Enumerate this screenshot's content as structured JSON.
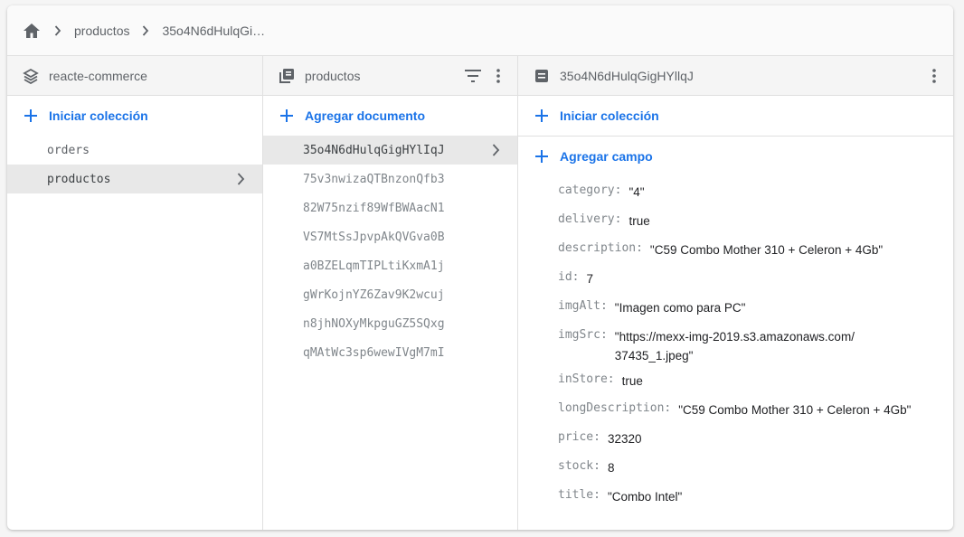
{
  "breadcrumb": {
    "items": [
      "productos",
      "35o4N6dHulqGi…"
    ]
  },
  "col1": {
    "title": "reacte-commerce",
    "action": "Iniciar colección",
    "items": [
      {
        "label": "orders",
        "selected": false
      },
      {
        "label": "productos",
        "selected": true
      }
    ]
  },
  "col2": {
    "title": "productos",
    "action": "Agregar documento",
    "items": [
      "35o4N6dHulqGigHYlIqJ",
      "75v3nwizaQTBnzonQfb3",
      "82W75nzif89WfBWAacN1",
      "VS7MtSsJpvpAkQVGva0B",
      "a0BZELqmTIPLtiKxmA1j",
      "gWrKojnYZ6Zav9K2wcuj",
      "n8jhNOXyMkpguGZ5SQxg",
      "qMAtWc3sp6wewIVgM7mI"
    ]
  },
  "col3": {
    "title": "35o4N6dHulqGigHYllqJ",
    "action_collection": "Iniciar colección",
    "action_field": "Agregar campo",
    "fields": [
      {
        "key": "category:",
        "value": "\"4\""
      },
      {
        "key": "delivery:",
        "value": "true"
      },
      {
        "key": "description:",
        "value": "\"C59 Combo Mother 310 + Celeron + 4Gb\""
      },
      {
        "key": "id:",
        "value": "7"
      },
      {
        "key": "imgAlt:",
        "value": "\"Imagen como para PC\""
      },
      {
        "key": "imgSrc:",
        "value": "\"https://mexx-img-2019.s3.amazonaws.com/37435_1.jpeg\""
      },
      {
        "key": "inStore:",
        "value": "true"
      },
      {
        "key": "longDescription:",
        "value": "\"C59 Combo Mother 310 + Celeron + 4Gb\""
      },
      {
        "key": "price:",
        "value": "32320"
      },
      {
        "key": "stock:",
        "value": "8"
      },
      {
        "key": "title:",
        "value": "\"Combo Intel\""
      }
    ]
  },
  "colors": {
    "accent": "#1a73e8",
    "selected_bg": "#e8e8e8",
    "header_bg": "#f5f5f5"
  }
}
